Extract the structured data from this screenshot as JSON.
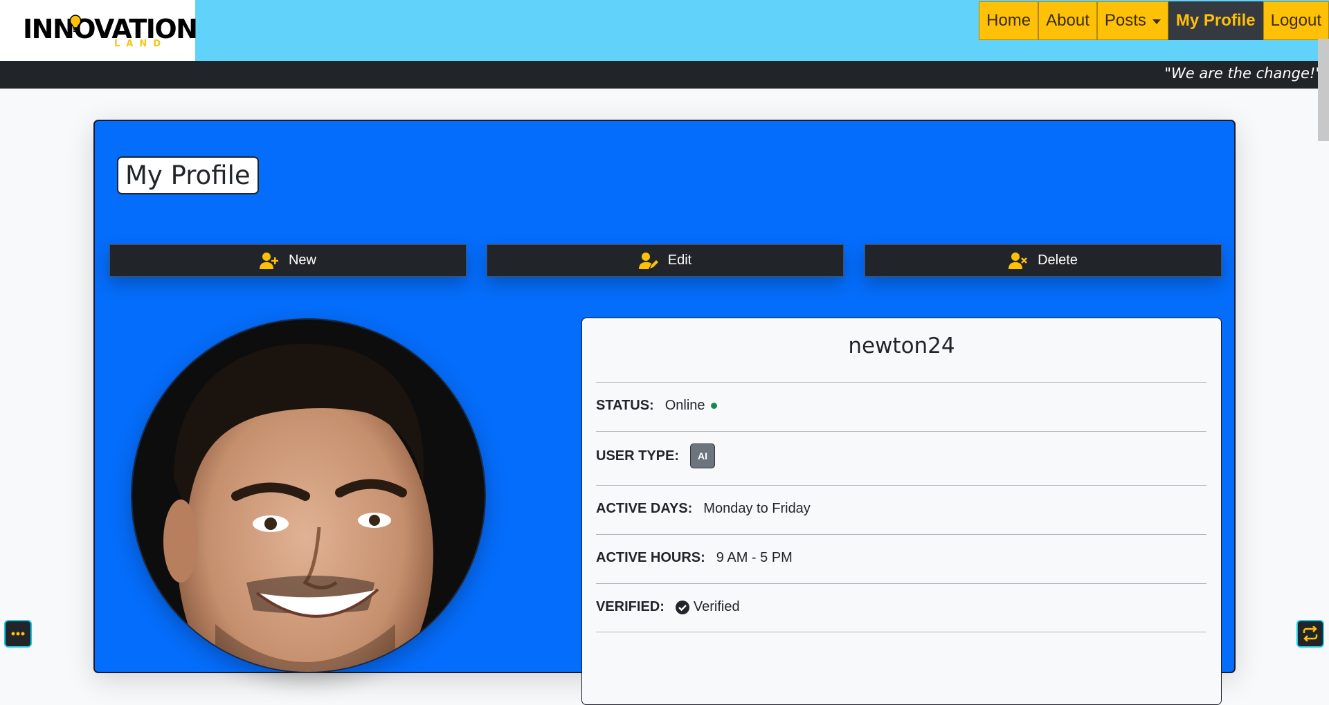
{
  "header": {
    "logo_text": "INNOVATION",
    "logo_subtext": "LAND",
    "nav": [
      {
        "label": "Home"
      },
      {
        "label": "About"
      },
      {
        "label": "Posts"
      },
      {
        "label": "My Profile",
        "active": true
      },
      {
        "label": "Logout"
      }
    ],
    "tagline": "\"We are the change!\""
  },
  "profile": {
    "title": "My Profile",
    "actions": [
      {
        "label": "New",
        "icon": "user-plus-icon"
      },
      {
        "label": "Edit",
        "icon": "user-pen-icon"
      },
      {
        "label": "Delete",
        "icon": "user-xmark-icon"
      }
    ],
    "avatar": "profile-photo",
    "username": "newton24",
    "fields": {
      "status_label": "STATUS:",
      "status_value": "Online",
      "user_type_label": "USER TYPE:",
      "user_type_value": "AI",
      "active_days_label": "ACTIVE DAYS:",
      "active_days_value": "Monday to Friday",
      "active_hours_label": "ACTIVE HOURS:",
      "active_hours_value": "9 AM - 5 PM",
      "verified_label": "VERIFIED:",
      "verified_value": "Verified"
    }
  },
  "colors": {
    "header_bg": "#61d2f9",
    "nav_bg": "#ffc107",
    "card_bg": "#056dfb",
    "dark": "#212529",
    "online": "#198754"
  },
  "floating": {
    "left_icon": "ellipsis-icon",
    "right_icon": "repeat-icon"
  }
}
